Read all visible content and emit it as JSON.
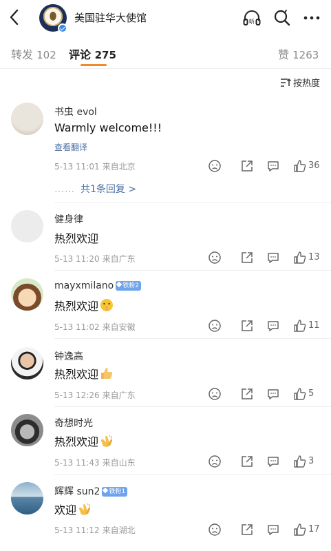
{
  "header": {
    "title": "美国驻华大使馆"
  },
  "tabs": {
    "repost_label": "转发",
    "repost_count": "102",
    "comment_label": "评论",
    "comment_count": "275",
    "like_label": "赞",
    "like_count": "1263"
  },
  "sort_label": "按热度",
  "comments": [
    {
      "name": "书虫 evol",
      "text": "Warmly welcome!!!",
      "translate": "查看翻译",
      "time": "5-13 11:01",
      "location": "来自北京",
      "likes": "36",
      "replies": "共1条回复 >"
    },
    {
      "name": "健身律",
      "text": "热烈欢迎",
      "time": "5-13 11:20",
      "location": "来自广东",
      "likes": "13"
    },
    {
      "name": "mayxmilano",
      "badge": "铁粉2",
      "text": "热烈欢迎",
      "emoji": "shush-face",
      "time": "5-13 11:02",
      "location": "来自安徽",
      "likes": "11"
    },
    {
      "name": "钟逸高",
      "text": "热烈欢迎",
      "emoji": "thumbs-up",
      "time": "5-13 12:26",
      "location": "来自广东",
      "likes": "5"
    },
    {
      "name": "奇想时光",
      "text": "热烈欢迎",
      "emoji": "clapping-hands",
      "time": "5-13 11:43",
      "location": "来自山东",
      "likes": "3"
    },
    {
      "name": "辉辉 sun2",
      "badge": "铁粉1",
      "text": "欢迎",
      "emoji": "clapping-hands",
      "time": "5-13 11:12",
      "location": "来自湖北",
      "likes": "17"
    }
  ]
}
